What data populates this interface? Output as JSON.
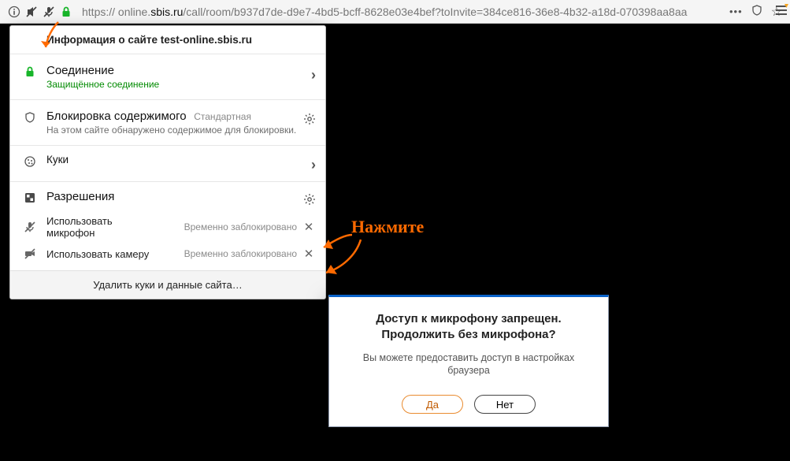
{
  "url": {
    "scheme": "https://",
    "prefix": " online.",
    "host": "sbis.ru",
    "path": "/call/room/b937d7de-d9e7-4bd5-bcff-8628e03e4bef?toInvite=384ce816-36e8-4b32-a18d-070398aa8aa"
  },
  "panel": {
    "header": "Информация о сайте test-online.sbis.ru",
    "connection": {
      "title": "Соединение",
      "sub": "Защищённое соединение"
    },
    "blocking": {
      "title": "Блокировка содержимого",
      "badge": "Стандартная",
      "sub": "На этом сайте обнаружено содержимое для блокировки."
    },
    "cookies": {
      "title": "Куки"
    },
    "permissions": {
      "title": "Разрешения",
      "items": [
        {
          "name": "Использовать микрофон",
          "status": "Временно заблокировано"
        },
        {
          "name": "Использовать камеру",
          "status": "Временно заблокировано"
        }
      ]
    },
    "footer": "Удалить куки и данные сайта…"
  },
  "annotation": {
    "label": "Нажмите"
  },
  "modal": {
    "title1": "Доступ к микрофону запрещен.",
    "title2": "Продолжить без микрофона?",
    "sub": "Вы можете предоставить доступ в настройках браузера",
    "yes": "Да",
    "no": "Нет"
  }
}
